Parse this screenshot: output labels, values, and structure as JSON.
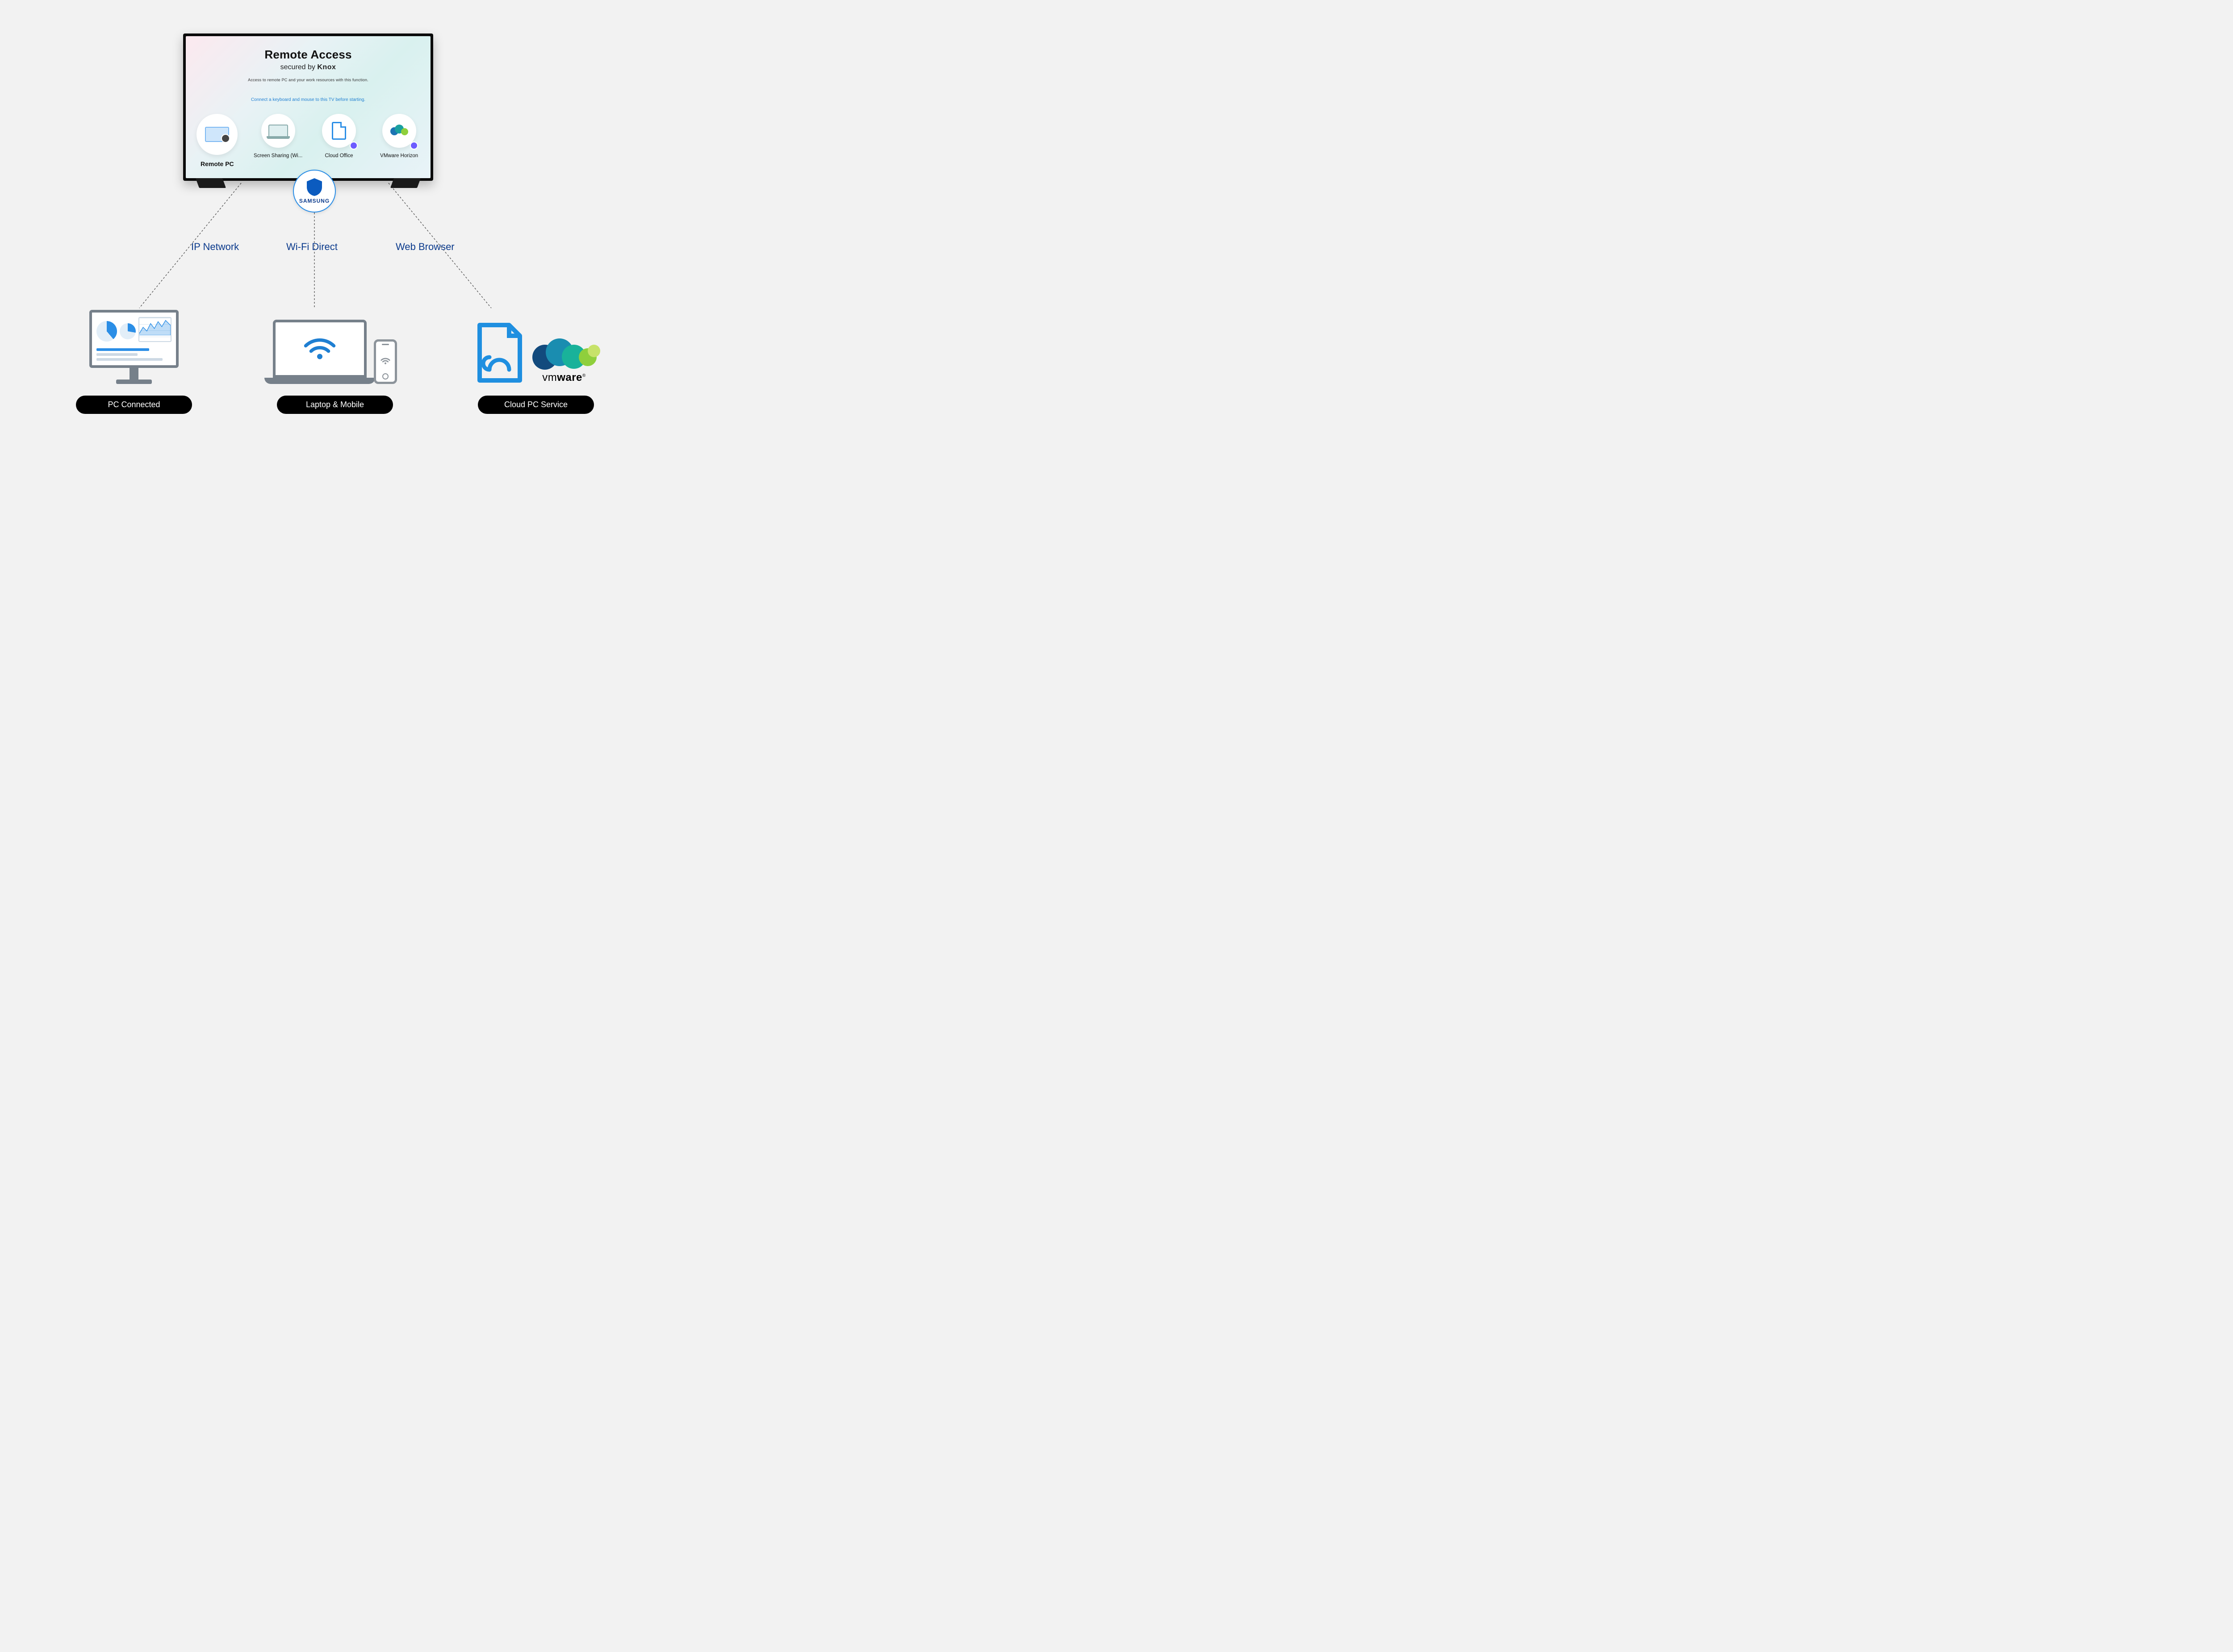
{
  "tv": {
    "title": "Remote Access",
    "subtitle_prefix": "secured by ",
    "subtitle_brand": "Knox",
    "description": "Access to remote PC and your work resources with this function.",
    "hint": "Connect a keyboard and mouse to this TV before starting.",
    "tiles": [
      {
        "label": "Remote PC",
        "icon": "monitor",
        "selected": true
      },
      {
        "label": "Screen Sharing (Wi...",
        "icon": "laptop",
        "selected": false
      },
      {
        "label": "Cloud Office",
        "icon": "cloud-doc",
        "selected": false,
        "badge": true
      },
      {
        "label": "VMware Horizon",
        "icon": "vmware",
        "selected": false,
        "badge": true
      }
    ]
  },
  "badge": {
    "brand": "SAMSUNG"
  },
  "connections": [
    {
      "label": "IP Network",
      "target": "pc"
    },
    {
      "label": "Wi-Fi Direct",
      "target": "laptop-mobile"
    },
    {
      "label": "Web Browser",
      "target": "cloud"
    }
  ],
  "devices": [
    {
      "pill": "PC Connected"
    },
    {
      "pill": "Laptop & Mobile"
    },
    {
      "pill": "Cloud PC Service"
    }
  ],
  "vmware_text_light": "vm",
  "vmware_text_bold": "ware",
  "vmware_reg": "®"
}
